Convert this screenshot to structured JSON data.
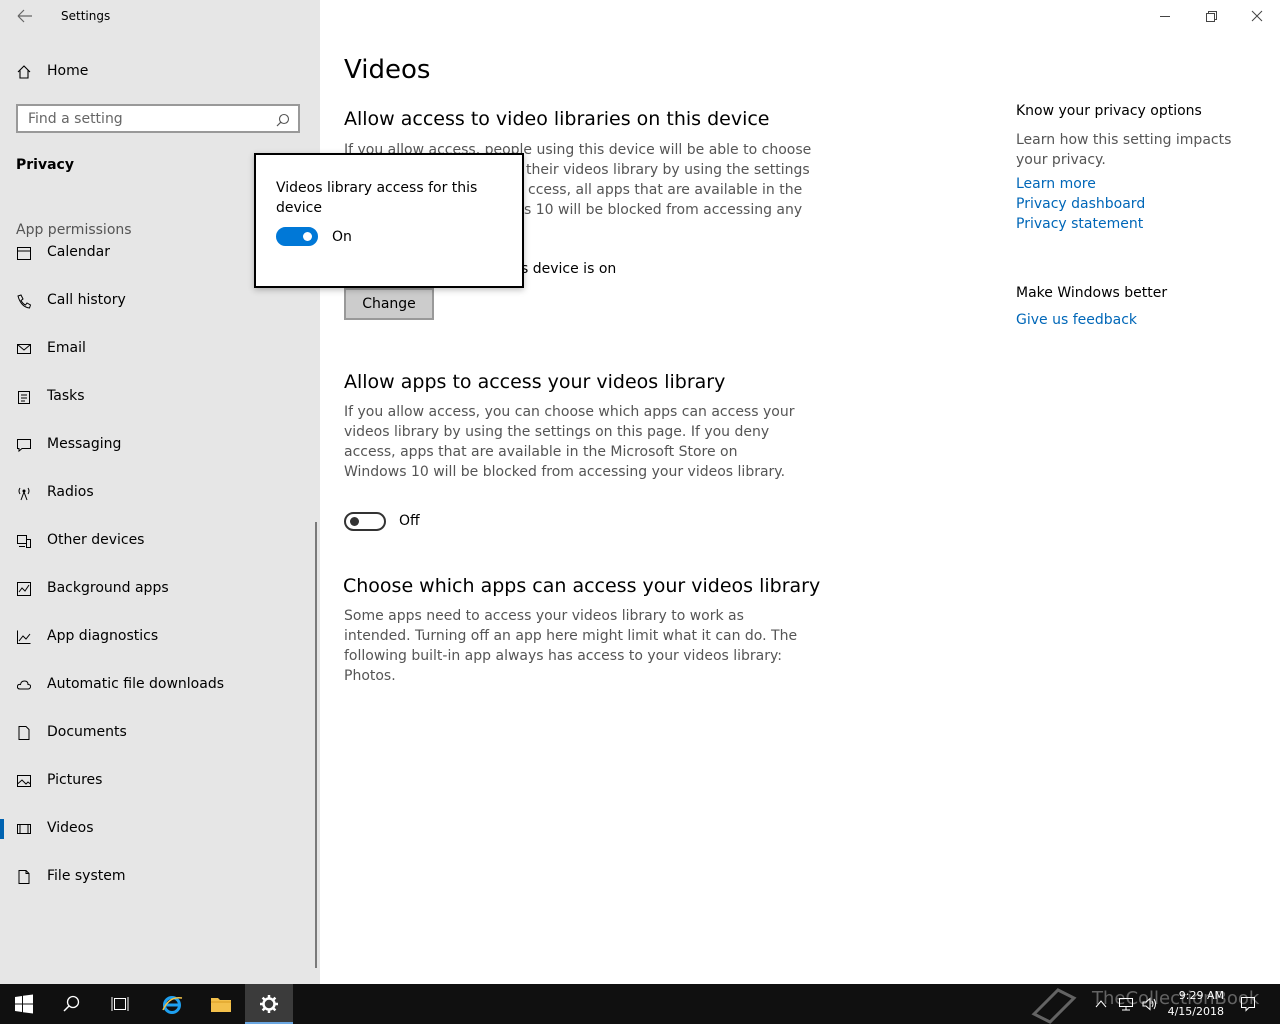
{
  "window": {
    "title": "Settings"
  },
  "sidebar": {
    "home_label": "Home",
    "search_placeholder": "Find a setting",
    "section_title": "Privacy",
    "group_title": "App permissions",
    "items": [
      {
        "label": "Calendar",
        "icon": "calendar-icon"
      },
      {
        "label": "Call history",
        "icon": "call-history-icon"
      },
      {
        "label": "Email",
        "icon": "email-icon"
      },
      {
        "label": "Tasks",
        "icon": "tasks-icon"
      },
      {
        "label": "Messaging",
        "icon": "messaging-icon"
      },
      {
        "label": "Radios",
        "icon": "radios-icon"
      },
      {
        "label": "Other devices",
        "icon": "other-devices-icon"
      },
      {
        "label": "Background apps",
        "icon": "background-apps-icon"
      },
      {
        "label": "App diagnostics",
        "icon": "app-diagnostics-icon"
      },
      {
        "label": "Automatic file downloads",
        "icon": "cloud-icon"
      },
      {
        "label": "Documents",
        "icon": "documents-icon"
      },
      {
        "label": "Pictures",
        "icon": "pictures-icon"
      },
      {
        "label": "Videos",
        "icon": "videos-icon",
        "selected": true
      },
      {
        "label": "File system",
        "icon": "file-system-icon"
      }
    ]
  },
  "main": {
    "page_title": "Videos",
    "section1": {
      "heading": "Allow access to video libraries on this device",
      "desc_line1": "If you allow access, people using this device will be able to choose",
      "desc_line2": "their videos library by using the settings",
      "desc_line3": "ccess, all apps that are available in the",
      "desc_line4": "s 10 will be blocked from accessing any",
      "status": "s device is on",
      "change_label": "Change"
    },
    "section2": {
      "heading": "Allow apps to access your videos library",
      "description": "If you allow access, you can choose which apps can access your videos library by using the settings on this page. If you deny access, apps that are available in the Microsoft Store on Windows 10 will be blocked from accessing your videos library.",
      "toggle_label": "Off",
      "toggle_on": false
    },
    "section3": {
      "heading": "Choose which apps can access your videos library",
      "description": "Some apps need to access your videos library to work as intended. Turning off an app here might limit what it can do. The following built-in app always has access to your videos library: Photos."
    }
  },
  "right_panel": {
    "privacy_heading": "Know your privacy options",
    "privacy_desc": "Learn how this setting impacts your privacy.",
    "links": [
      "Learn more",
      "Privacy dashboard",
      "Privacy statement"
    ],
    "feedback_heading": "Make Windows better",
    "feedback_link": "Give us feedback"
  },
  "popup": {
    "title": "Videos library access for this device",
    "toggle_label": "On",
    "toggle_on": true
  },
  "taskbar": {
    "time": "9:29 AM",
    "date": "4/15/2018",
    "watermark": "TheCollectionBook",
    "accent_color": "#0078d7"
  }
}
